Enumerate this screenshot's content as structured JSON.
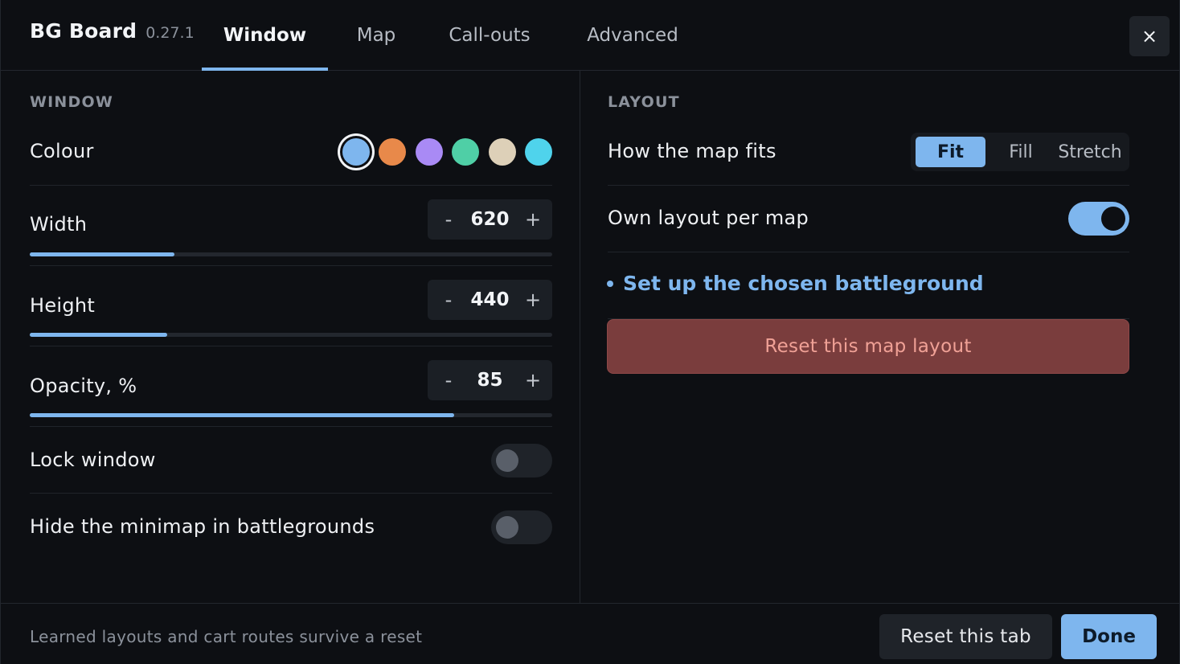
{
  "app": {
    "name": "BG Board",
    "version": "0.27.1"
  },
  "tabs": [
    {
      "label": "Window",
      "active": true
    },
    {
      "label": "Map",
      "active": false
    },
    {
      "label": "Call-outs",
      "active": false
    },
    {
      "label": "Advanced",
      "active": false
    }
  ],
  "close_label": "×",
  "window_section": {
    "title": "WINDOW",
    "colour": {
      "label": "Colour",
      "swatches": [
        "#7eb6ee",
        "#e8894a",
        "#a98af5",
        "#4fcfa6",
        "#ddd0b8",
        "#4fd3ec"
      ],
      "selected_index": 0
    },
    "width": {
      "label": "Width",
      "value": "620",
      "fill_fraction": 0.277
    },
    "height": {
      "label": "Height",
      "value": "440",
      "fill_fraction": 0.263
    },
    "opacity": {
      "label": "Opacity, %",
      "value": "85",
      "fill_fraction": 0.812
    },
    "stepper": {
      "minus": "-",
      "plus": "+"
    },
    "lock_window": {
      "label": "Lock window",
      "on": false
    },
    "hide_minimap": {
      "label": "Hide the minimap in battlegrounds",
      "on": false
    }
  },
  "layout_section": {
    "title": "LAYOUT",
    "map_fit": {
      "label": "How the map fits",
      "options": [
        "Fit",
        "Fill",
        "Stretch"
      ],
      "selected": "Fit"
    },
    "own_layout": {
      "label": "Own layout per map",
      "on": true
    },
    "link_label": "Set up the chosen battleground",
    "reset_map_label": "Reset this map layout"
  },
  "footer": {
    "note": "Learned layouts and cart routes survive a reset",
    "reset_tab_label": "Reset this tab",
    "done_label": "Done"
  },
  "colors": {
    "accent": "#7eb6ee",
    "danger_bg": "#7a3d3d",
    "danger_text": "#f0a196",
    "background": "#0d0f13"
  }
}
